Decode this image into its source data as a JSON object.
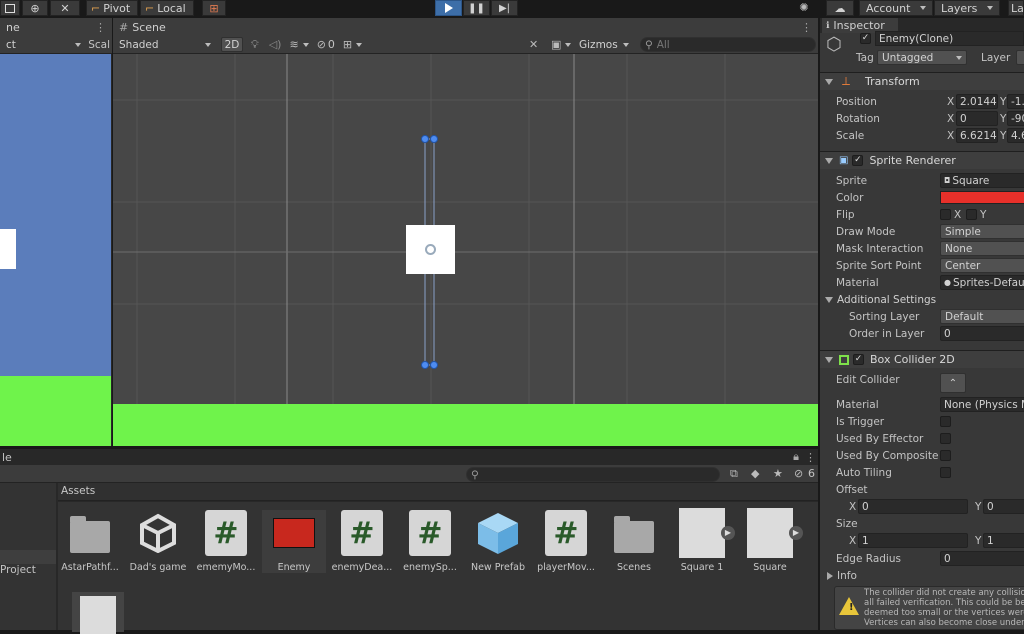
{
  "toolbar": {
    "pivot": "Pivot",
    "local": "Local",
    "account": "Account",
    "layers": "Layers",
    "layout_partial": "La"
  },
  "game_view": {
    "tab_partial": "ne",
    "aspect_partial": "ct",
    "scale_partial": "Scal",
    "colors": {
      "sky": "#5b7dbb",
      "ground": "#6ff34b"
    }
  },
  "scene": {
    "tab_label": "Scene",
    "shading": "Shaded",
    "mode_2d": "2D",
    "hidden_count": "0",
    "gizmos": "Gizmos",
    "search_placeholder": "All",
    "colors": {
      "background": "#474747",
      "ground": "#6ff34b",
      "square": "#ffffff"
    }
  },
  "project": {
    "tab_partial": "le",
    "badge_count": "6",
    "breadcrumb": "Assets",
    "sidebar_item": "Project",
    "assets": [
      {
        "name": "AstarPathf...",
        "icon": "folder-icon"
      },
      {
        "name": "Dad's game",
        "icon": "unity-scene-icon"
      },
      {
        "name": "ememyMo...",
        "icon": "csharp-script-icon"
      },
      {
        "name": "Enemy",
        "icon": "prefab-thumbnail-red"
      },
      {
        "name": "enemyDea...",
        "icon": "csharp-script-icon"
      },
      {
        "name": "enemySp...",
        "icon": "csharp-script-icon"
      },
      {
        "name": "New Prefab",
        "icon": "prefab-cube-icon"
      },
      {
        "name": "playerMov...",
        "icon": "csharp-script-icon"
      },
      {
        "name": "Scenes",
        "icon": "folder-icon"
      },
      {
        "name": "Square 1",
        "icon": "sprite-thumbnail"
      },
      {
        "name": "Square",
        "icon": "sprite-thumbnail"
      }
    ]
  },
  "inspector": {
    "tab_label": "Inspector",
    "object_name": "Enemy(Clone)",
    "tag_label": "Tag",
    "tag_value": "Untagged",
    "layer_label": "Layer",
    "transform": {
      "title": "Transform",
      "position_label": "Position",
      "position_x": "2.0144",
      "position_y_partial": "-1.",
      "rotation_label": "Rotation",
      "rotation_x": "0",
      "rotation_y_partial": "-90",
      "scale_label": "Scale",
      "scale_x": "6.6214",
      "scale_y_partial": "4.6"
    },
    "sprite_renderer": {
      "title": "Sprite Renderer",
      "sprite_label": "Sprite",
      "sprite_value": "Square",
      "color_label": "Color",
      "color_value": "#e8302a",
      "flip_label": "Flip",
      "flip_x": "X",
      "flip_y": "Y",
      "draw_mode_label": "Draw Mode",
      "draw_mode_value": "Simple",
      "mask_label": "Mask Interaction",
      "mask_value": "None",
      "sort_point_label": "Sprite Sort Point",
      "sort_point_value": "Center",
      "material_label": "Material",
      "material_value": "Sprites-Default",
      "additional": "Additional Settings",
      "sorting_layer_label": "Sorting Layer",
      "sorting_layer_value": "Default",
      "order_label": "Order in Layer",
      "order_value": "0"
    },
    "box_collider": {
      "title": "Box Collider 2D",
      "edit_label": "Edit Collider",
      "material_label": "Material",
      "material_value": "None (Physics M",
      "is_trigger": "Is Trigger",
      "used_by_effector": "Used By Effector",
      "used_by_composite": "Used By Composite",
      "auto_tiling": "Auto Tiling",
      "offset_label": "Offset",
      "offset_x": "0",
      "offset_y": "0",
      "size_label": "Size",
      "size_x": "1",
      "size_y": "1",
      "edge_radius_label": "Edge Radius",
      "edge_radius_value": "0",
      "info_label": "Info",
      "warning_line1": "The collider did not create any collision",
      "warning_line2": "all failed verification.  This could be bec",
      "warning_line3": "deemed too small or the vertices were",
      "warning_line4": "Vertices can also become close under"
    }
  }
}
